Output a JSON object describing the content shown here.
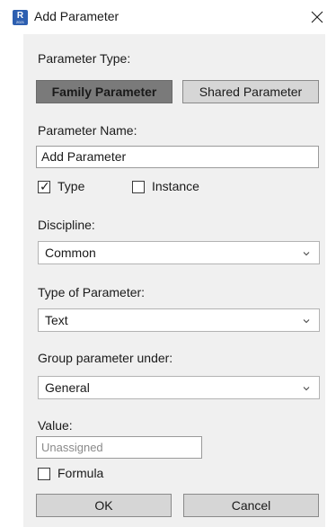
{
  "window": {
    "title": "Add Parameter",
    "app_icon_letter": "R",
    "app_icon_sub": "2021",
    "close_glyph": "✕"
  },
  "parameter_type": {
    "label": "Parameter Type:",
    "family_label": "Family Parameter",
    "shared_label": "Shared Parameter",
    "selected": "Family Parameter"
  },
  "parameter_name": {
    "label": "Parameter Name:",
    "value": "Add Parameter"
  },
  "scope": {
    "type_label": "Type",
    "type_checked": true,
    "instance_label": "Instance",
    "instance_checked": false,
    "check_glyph": "✓"
  },
  "discipline": {
    "label": "Discipline:",
    "value": "Common"
  },
  "type_of_parameter": {
    "label": "Type of Parameter:",
    "value": "Text"
  },
  "group_under": {
    "label": "Group parameter under:",
    "value": "General"
  },
  "value": {
    "label": "Value:",
    "placeholder": "Unassigned"
  },
  "formula": {
    "label": "Formula",
    "checked": false
  },
  "footer": {
    "ok_label": "OK",
    "cancel_label": "Cancel"
  },
  "colors": {
    "panel_bg": "#f0f0f0",
    "button_bg": "#d6d6d6",
    "button_active_bg": "#7a7a7a",
    "icon_blue": "#2d5fb0"
  },
  "icons": {
    "app": "revit-app-icon",
    "close": "close-icon",
    "dropdown": "chevron-down-icon",
    "check": "checkmark-icon"
  }
}
